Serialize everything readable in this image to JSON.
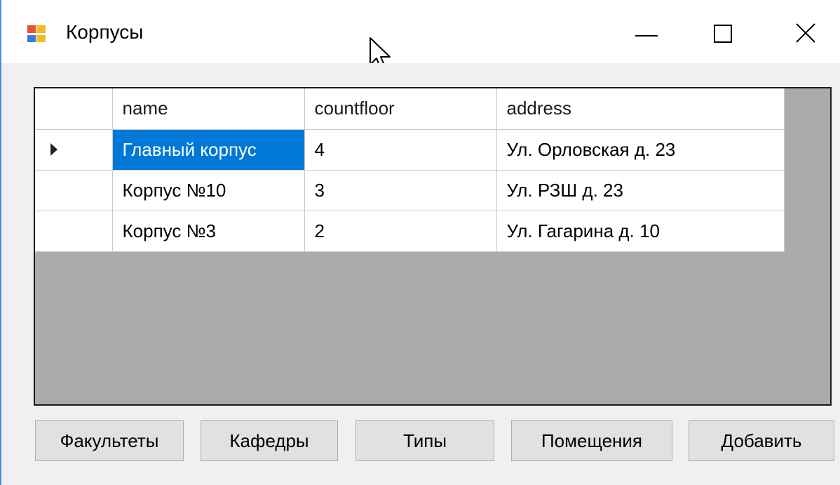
{
  "window": {
    "title": "Корпусы",
    "controls": [
      "minimize",
      "maximize",
      "close"
    ]
  },
  "grid": {
    "columns": [
      "name",
      "countfloor",
      "address"
    ],
    "rows": [
      {
        "name": "Главный корпус",
        "countfloor": "4",
        "address": "Ул. Орловская д. 23",
        "current": true
      },
      {
        "name": "Корпус №10",
        "countfloor": "3",
        "address": "Ул. РЗШ д. 23",
        "current": false
      },
      {
        "name": "Корпус №3",
        "countfloor": "2",
        "address": "Ул. Гагарина д. 10",
        "current": false
      }
    ],
    "selected_cell": {
      "row": 0,
      "column": "name"
    }
  },
  "buttons": {
    "faculties": "Факультеты",
    "departments": "Кафедры",
    "types": "Типы",
    "rooms": "Помещения",
    "add": "Добавить"
  },
  "icons": {
    "app": "form-icon",
    "minimize": "minimize-icon",
    "maximize": "maximize-icon",
    "close": "close-icon",
    "row_indicator": "row-pointer-icon",
    "cursor": "mouse-cursor-icon"
  },
  "colors": {
    "selection": "#0078d7",
    "grid_background": "#ababab",
    "window_background": "#f0f0f0",
    "button_face": "#e1e1e1"
  }
}
